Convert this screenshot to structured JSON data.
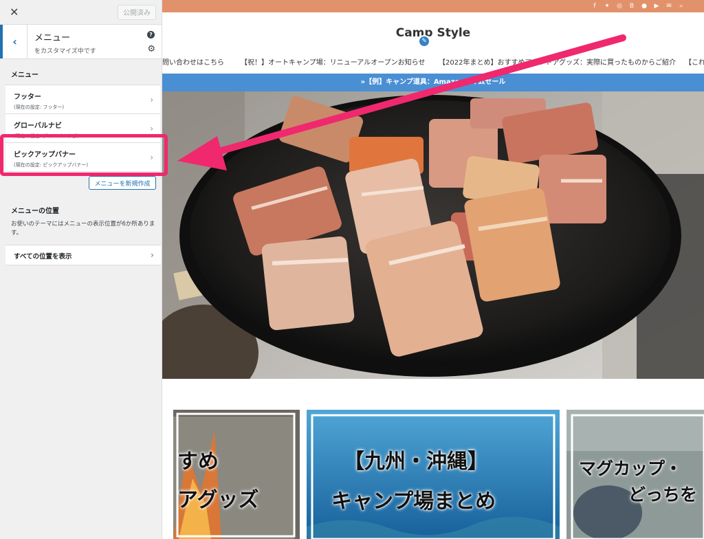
{
  "sidebar": {
    "publish_label": "公開済み",
    "header_title": "メニュー",
    "header_subtitle": "をカスタマイズ中です",
    "section_title": "メニュー",
    "menus": [
      {
        "name": "フッター",
        "sub": "(現在の設定: フッター)"
      },
      {
        "name": "グローバルナビ",
        "sub": "(現在の設定: グローバルナビ)"
      },
      {
        "name": "ピックアップバナー",
        "sub": "(現在の設定: ピックアップバナー)"
      }
    ],
    "new_menu_label": "メニューを新規作成",
    "locations_title": "メニューの位置",
    "locations_desc": "お使いのテーマにはメニューの表示位置が6か所あります。",
    "all_locations_label": "すべての位置を表示"
  },
  "preview": {
    "site_title": "Camp Style",
    "nav": [
      "問い合わせはこちら",
      "【祝！】オートキャンプ場：リニューアルオープンお知らせ",
      "【2022年まとめ】おすすめアウトドアグッズ：実際に買ったものからご紹介",
      "【これ"
    ],
    "banner_text": "»【例】キャンプ道具：Amazonタイムセール",
    "cards": [
      {
        "line1": "すめ",
        "line2": "アグッズ"
      },
      {
        "line1": "【九州・沖縄】",
        "line2": "キャンプ場まとめ"
      },
      {
        "line1": "マグカップ・",
        "line2": "どっちを"
      }
    ]
  },
  "colors": {
    "accent_blue": "#2271b1",
    "highlight_pink": "#f0286e",
    "topbar_orange": "#e2926a",
    "banner_blue": "#4a8fd4"
  }
}
